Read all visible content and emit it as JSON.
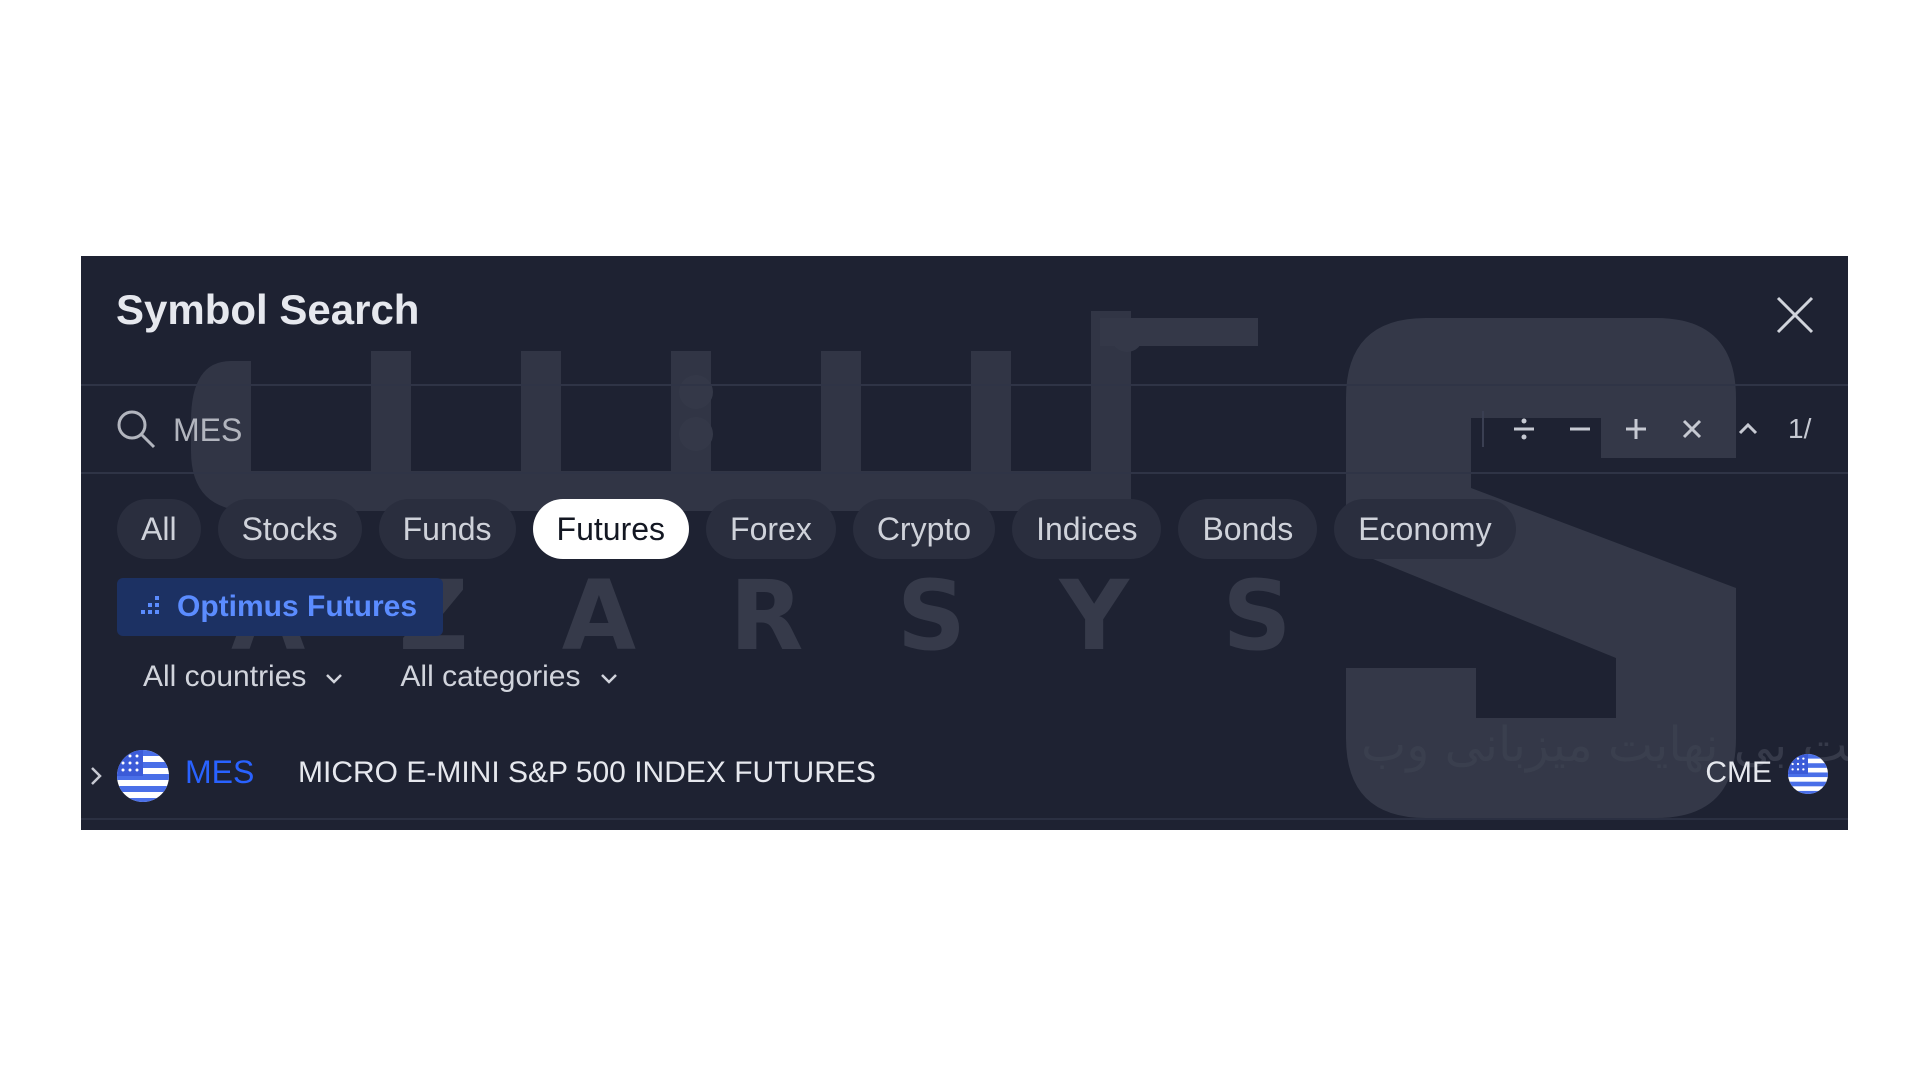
{
  "dialog": {
    "title": "Symbol Search",
    "close_icon": "close-icon"
  },
  "search": {
    "value": "MES",
    "icon": "search-icon",
    "calc": {
      "buttons": [
        "divide-icon",
        "minus-icon",
        "plus-icon",
        "multiply-icon",
        "caret-up-icon"
      ],
      "count": "1/"
    }
  },
  "tabs": [
    {
      "label": "All",
      "active": false
    },
    {
      "label": "Stocks",
      "active": false
    },
    {
      "label": "Funds",
      "active": false
    },
    {
      "label": "Futures",
      "active": true
    },
    {
      "label": "Forex",
      "active": false
    },
    {
      "label": "Crypto",
      "active": false
    },
    {
      "label": "Indices",
      "active": false
    },
    {
      "label": "Bonds",
      "active": false
    },
    {
      "label": "Economy",
      "active": false
    }
  ],
  "source": {
    "label": "Optimus Futures",
    "icon": "broker-icon"
  },
  "filters": {
    "countries": "All countries",
    "categories": "All categories"
  },
  "results": [
    {
      "symbol": "MES",
      "description": "MICRO E-MINI S&P 500 INDEX FUTURES",
      "exchange": "CME",
      "flag": "us-flag-icon"
    }
  ],
  "watermark": {
    "arabic_top": "آخسیس",
    "latin": "A Z A R S Y S",
    "arabic_tagline": "سرعت بی نهایت میزبانی وب"
  },
  "colors": {
    "background": "#1e2232",
    "accent": "#2962ff",
    "active_tab": "#ffffff"
  }
}
